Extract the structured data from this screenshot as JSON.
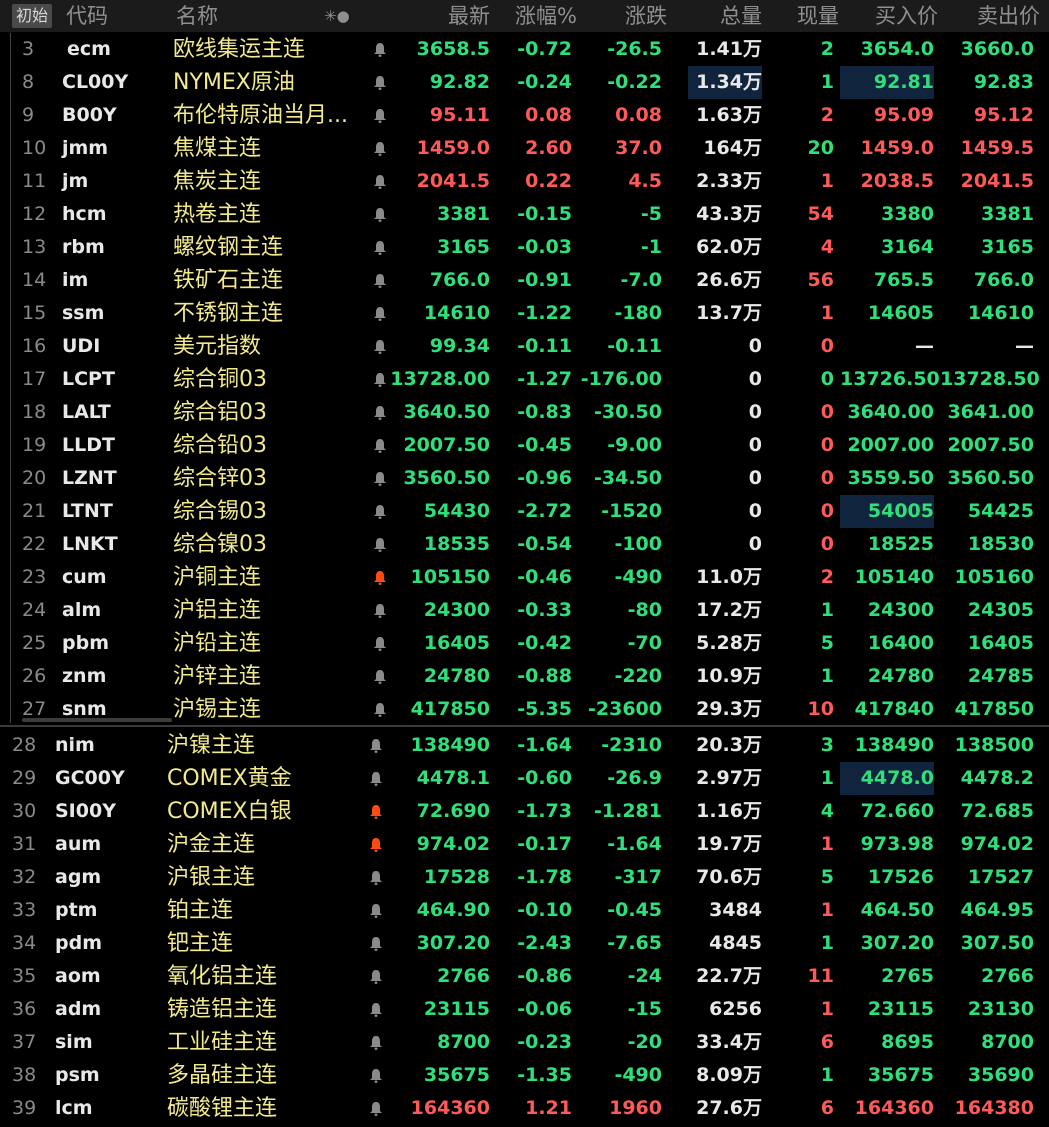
{
  "header": {
    "initial_button": "初始",
    "columns": {
      "code": "代码",
      "name": "名称",
      "icons": "✳●",
      "last": "最新",
      "pct": "涨幅%",
      "chg": "涨跌",
      "vol": "总量",
      "cur": "现量",
      "bid": "买入价",
      "ask": "卖出价"
    }
  },
  "colors": {
    "up": "#ff5a5a",
    "down": "#2fe07a",
    "name": "#f2ea8c",
    "alert_active": "#ff4a14"
  },
  "rows": [
    {
      "seq": "3",
      "code": "ecm",
      "name": "欧线集运主连",
      "alert": false,
      "last": "3658.5",
      "pct": "-0.72",
      "chg": "-26.5",
      "vol": "1.41万",
      "cur": "2",
      "bid": "3654.0",
      "ask": "3660.0",
      "c_price": "down",
      "c_cur": "down",
      "c_bid": "down",
      "c_ask": "down"
    },
    {
      "seq": "8",
      "code": "CL00Y",
      "name": "NYMEX原油",
      "alert": false,
      "last": "92.82",
      "pct": "-0.24",
      "chg": "-0.22",
      "vol": "1.34万",
      "cur": "1",
      "bid": "92.81",
      "ask": "92.83",
      "c_price": "down",
      "c_cur": "down",
      "c_bid": "down",
      "c_ask": "down",
      "hl_vol": true,
      "hl_bid": true
    },
    {
      "seq": "9",
      "code": "B00Y",
      "name": "布伦特原油当月...",
      "alert": false,
      "last": "95.11",
      "pct": "0.08",
      "chg": "0.08",
      "vol": "1.63万",
      "cur": "2",
      "bid": "95.09",
      "ask": "95.12",
      "c_price": "up",
      "c_cur": "up",
      "c_bid": "up",
      "c_ask": "up"
    },
    {
      "seq": "10",
      "code": "jmm",
      "name": "焦煤主连",
      "alert": false,
      "last": "1459.0",
      "pct": "2.60",
      "chg": "37.0",
      "vol": "164万",
      "cur": "20",
      "bid": "1459.0",
      "ask": "1459.5",
      "c_price": "up",
      "c_cur": "down",
      "c_bid": "up",
      "c_ask": "up"
    },
    {
      "seq": "11",
      "code": "jm",
      "name": "焦炭主连",
      "alert": false,
      "last": "2041.5",
      "pct": "0.22",
      "chg": "4.5",
      "vol": "2.33万",
      "cur": "1",
      "bid": "2038.5",
      "ask": "2041.5",
      "c_price": "up",
      "c_cur": "up",
      "c_bid": "up",
      "c_ask": "up"
    },
    {
      "seq": "12",
      "code": "hcm",
      "name": "热卷主连",
      "alert": false,
      "last": "3381",
      "pct": "-0.15",
      "chg": "-5",
      "vol": "43.3万",
      "cur": "54",
      "bid": "3380",
      "ask": "3381",
      "c_price": "down",
      "c_cur": "up",
      "c_bid": "down",
      "c_ask": "down"
    },
    {
      "seq": "13",
      "code": "rbm",
      "name": "螺纹钢主连",
      "alert": false,
      "last": "3165",
      "pct": "-0.03",
      "chg": "-1",
      "vol": "62.0万",
      "cur": "4",
      "bid": "3164",
      "ask": "3165",
      "c_price": "down",
      "c_cur": "up",
      "c_bid": "down",
      "c_ask": "down"
    },
    {
      "seq": "14",
      "code": "im",
      "name": "铁矿石主连",
      "alert": false,
      "last": "766.0",
      "pct": "-0.91",
      "chg": "-7.0",
      "vol": "26.6万",
      "cur": "56",
      "bid": "765.5",
      "ask": "766.0",
      "c_price": "down",
      "c_cur": "up",
      "c_bid": "down",
      "c_ask": "down"
    },
    {
      "seq": "15",
      "code": "ssm",
      "name": "不锈钢主连",
      "alert": false,
      "last": "14610",
      "pct": "-1.22",
      "chg": "-180",
      "vol": "13.7万",
      "cur": "1",
      "bid": "14605",
      "ask": "14610",
      "c_price": "down",
      "c_cur": "up",
      "c_bid": "down",
      "c_ask": "down"
    },
    {
      "seq": "16",
      "code": "UDI",
      "name": "美元指数",
      "alert": false,
      "last": "99.34",
      "pct": "-0.11",
      "chg": "-0.11",
      "vol": "0",
      "cur": "0",
      "bid": "—",
      "ask": "—",
      "c_price": "down",
      "c_cur": "up",
      "c_bid": "flat",
      "c_ask": "flat"
    },
    {
      "seq": "17",
      "code": "LCPT",
      "name": "综合铜03",
      "alert": false,
      "last": "13728.00",
      "pct": "-1.27",
      "chg": "-176.00",
      "vol": "0",
      "cur": "0",
      "bid": "13726.50",
      "ask": "13728.50",
      "c_price": "down",
      "c_cur": "down",
      "c_bid": "down",
      "c_ask": "down"
    },
    {
      "seq": "18",
      "code": "LALT",
      "name": "综合铝03",
      "alert": false,
      "last": "3640.50",
      "pct": "-0.83",
      "chg": "-30.50",
      "vol": "0",
      "cur": "0",
      "bid": "3640.00",
      "ask": "3641.00",
      "c_price": "down",
      "c_cur": "up",
      "c_bid": "down",
      "c_ask": "down"
    },
    {
      "seq": "19",
      "code": "LLDT",
      "name": "综合铅03",
      "alert": false,
      "last": "2007.50",
      "pct": "-0.45",
      "chg": "-9.00",
      "vol": "0",
      "cur": "0",
      "bid": "2007.00",
      "ask": "2007.50",
      "c_price": "down",
      "c_cur": "up",
      "c_bid": "down",
      "c_ask": "down"
    },
    {
      "seq": "20",
      "code": "LZNT",
      "name": "综合锌03",
      "alert": false,
      "last": "3560.50",
      "pct": "-0.96",
      "chg": "-34.50",
      "vol": "0",
      "cur": "0",
      "bid": "3559.50",
      "ask": "3560.50",
      "c_price": "down",
      "c_cur": "up",
      "c_bid": "down",
      "c_ask": "down"
    },
    {
      "seq": "21",
      "code": "LTNT",
      "name": "综合锡03",
      "alert": false,
      "last": "54430",
      "pct": "-2.72",
      "chg": "-1520",
      "vol": "0",
      "cur": "0",
      "bid": "54005",
      "ask": "54425",
      "c_price": "down",
      "c_cur": "up",
      "c_bid": "down",
      "c_ask": "down",
      "hl_bid": true
    },
    {
      "seq": "22",
      "code": "LNKT",
      "name": "综合镍03",
      "alert": false,
      "last": "18535",
      "pct": "-0.54",
      "chg": "-100",
      "vol": "0",
      "cur": "0",
      "bid": "18525",
      "ask": "18530",
      "c_price": "down",
      "c_cur": "up",
      "c_bid": "down",
      "c_ask": "down"
    },
    {
      "seq": "23",
      "code": "cum",
      "name": "沪铜主连",
      "alert": true,
      "last": "105150",
      "pct": "-0.46",
      "chg": "-490",
      "vol": "11.0万",
      "cur": "2",
      "bid": "105140",
      "ask": "105160",
      "c_price": "down",
      "c_cur": "up",
      "c_bid": "down",
      "c_ask": "down"
    },
    {
      "seq": "24",
      "code": "alm",
      "name": "沪铝主连",
      "alert": false,
      "last": "24300",
      "pct": "-0.33",
      "chg": "-80",
      "vol": "17.2万",
      "cur": "1",
      "bid": "24300",
      "ask": "24305",
      "c_price": "down",
      "c_cur": "down",
      "c_bid": "down",
      "c_ask": "down"
    },
    {
      "seq": "25",
      "code": "pbm",
      "name": "沪铅主连",
      "alert": false,
      "last": "16405",
      "pct": "-0.42",
      "chg": "-70",
      "vol": "5.28万",
      "cur": "5",
      "bid": "16400",
      "ask": "16405",
      "c_price": "down",
      "c_cur": "down",
      "c_bid": "down",
      "c_ask": "down"
    },
    {
      "seq": "26",
      "code": "znm",
      "name": "沪锌主连",
      "alert": false,
      "last": "24780",
      "pct": "-0.88",
      "chg": "-220",
      "vol": "10.9万",
      "cur": "1",
      "bid": "24780",
      "ask": "24785",
      "c_price": "down",
      "c_cur": "down",
      "c_bid": "down",
      "c_ask": "down"
    },
    {
      "seq": "27",
      "code": "snm",
      "name": "沪锡主连",
      "alert": false,
      "last": "417850",
      "pct": "-5.35",
      "chg": "-23600",
      "vol": "29.3万",
      "cur": "10",
      "bid": "417840",
      "ask": "417850",
      "c_price": "down",
      "c_cur": "up",
      "c_bid": "down",
      "c_ask": "down"
    },
    {
      "seq": "28",
      "code": "nim",
      "name": "沪镍主连",
      "alert": false,
      "last": "138490",
      "pct": "-1.64",
      "chg": "-2310",
      "vol": "20.3万",
      "cur": "3",
      "bid": "138490",
      "ask": "138500",
      "c_price": "down",
      "c_cur": "down",
      "c_bid": "down",
      "c_ask": "down"
    },
    {
      "seq": "29",
      "code": "GC00Y",
      "name": "COMEX黄金",
      "alert": false,
      "last": "4478.1",
      "pct": "-0.60",
      "chg": "-26.9",
      "vol": "2.97万",
      "cur": "1",
      "bid": "4478.0",
      "ask": "4478.2",
      "c_price": "down",
      "c_cur": "down",
      "c_bid": "down",
      "c_ask": "down",
      "hl_bid": true
    },
    {
      "seq": "30",
      "code": "SI00Y",
      "name": "COMEX白银",
      "alert": true,
      "last": "72.690",
      "pct": "-1.73",
      "chg": "-1.281",
      "vol": "1.16万",
      "cur": "4",
      "bid": "72.660",
      "ask": "72.685",
      "c_price": "down",
      "c_cur": "down",
      "c_bid": "down",
      "c_ask": "down"
    },
    {
      "seq": "31",
      "code": "aum",
      "name": "沪金主连",
      "alert": true,
      "last": "974.02",
      "pct": "-0.17",
      "chg": "-1.64",
      "vol": "19.7万",
      "cur": "1",
      "bid": "973.98",
      "ask": "974.02",
      "c_price": "down",
      "c_cur": "up",
      "c_bid": "down",
      "c_ask": "down"
    },
    {
      "seq": "32",
      "code": "agm",
      "name": "沪银主连",
      "alert": false,
      "last": "17528",
      "pct": "-1.78",
      "chg": "-317",
      "vol": "70.6万",
      "cur": "5",
      "bid": "17526",
      "ask": "17527",
      "c_price": "down",
      "c_cur": "down",
      "c_bid": "down",
      "c_ask": "down"
    },
    {
      "seq": "33",
      "code": "ptm",
      "name": "铂主连",
      "alert": false,
      "last": "464.90",
      "pct": "-0.10",
      "chg": "-0.45",
      "vol": "3484",
      "cur": "1",
      "bid": "464.50",
      "ask": "464.95",
      "c_price": "down",
      "c_cur": "up",
      "c_bid": "down",
      "c_ask": "down"
    },
    {
      "seq": "34",
      "code": "pdm",
      "name": "钯主连",
      "alert": false,
      "last": "307.20",
      "pct": "-2.43",
      "chg": "-7.65",
      "vol": "4845",
      "cur": "1",
      "bid": "307.20",
      "ask": "307.50",
      "c_price": "down",
      "c_cur": "down",
      "c_bid": "down",
      "c_ask": "down"
    },
    {
      "seq": "35",
      "code": "aom",
      "name": "氧化铝主连",
      "alert": false,
      "last": "2766",
      "pct": "-0.86",
      "chg": "-24",
      "vol": "22.7万",
      "cur": "11",
      "bid": "2765",
      "ask": "2766",
      "c_price": "down",
      "c_cur": "up",
      "c_bid": "down",
      "c_ask": "down"
    },
    {
      "seq": "36",
      "code": "adm",
      "name": "铸造铝主连",
      "alert": false,
      "last": "23115",
      "pct": "-0.06",
      "chg": "-15",
      "vol": "6256",
      "cur": "1",
      "bid": "23115",
      "ask": "23130",
      "c_price": "down",
      "c_cur": "up",
      "c_bid": "down",
      "c_ask": "down"
    },
    {
      "seq": "37",
      "code": "sim",
      "name": "工业硅主连",
      "alert": false,
      "last": "8700",
      "pct": "-0.23",
      "chg": "-20",
      "vol": "33.4万",
      "cur": "6",
      "bid": "8695",
      "ask": "8700",
      "c_price": "down",
      "c_cur": "up",
      "c_bid": "down",
      "c_ask": "down"
    },
    {
      "seq": "38",
      "code": "psm",
      "name": "多晶硅主连",
      "alert": false,
      "last": "35675",
      "pct": "-1.35",
      "chg": "-490",
      "vol": "8.09万",
      "cur": "1",
      "bid": "35675",
      "ask": "35690",
      "c_price": "down",
      "c_cur": "down",
      "c_bid": "down",
      "c_ask": "down"
    },
    {
      "seq": "39",
      "code": "lcm",
      "name": "碳酸锂主连",
      "alert": false,
      "last": "164360",
      "pct": "1.21",
      "chg": "1960",
      "vol": "27.6万",
      "cur": "6",
      "bid": "164360",
      "ask": "164380",
      "c_price": "up",
      "c_cur": "up",
      "c_bid": "up",
      "c_ask": "up"
    }
  ]
}
